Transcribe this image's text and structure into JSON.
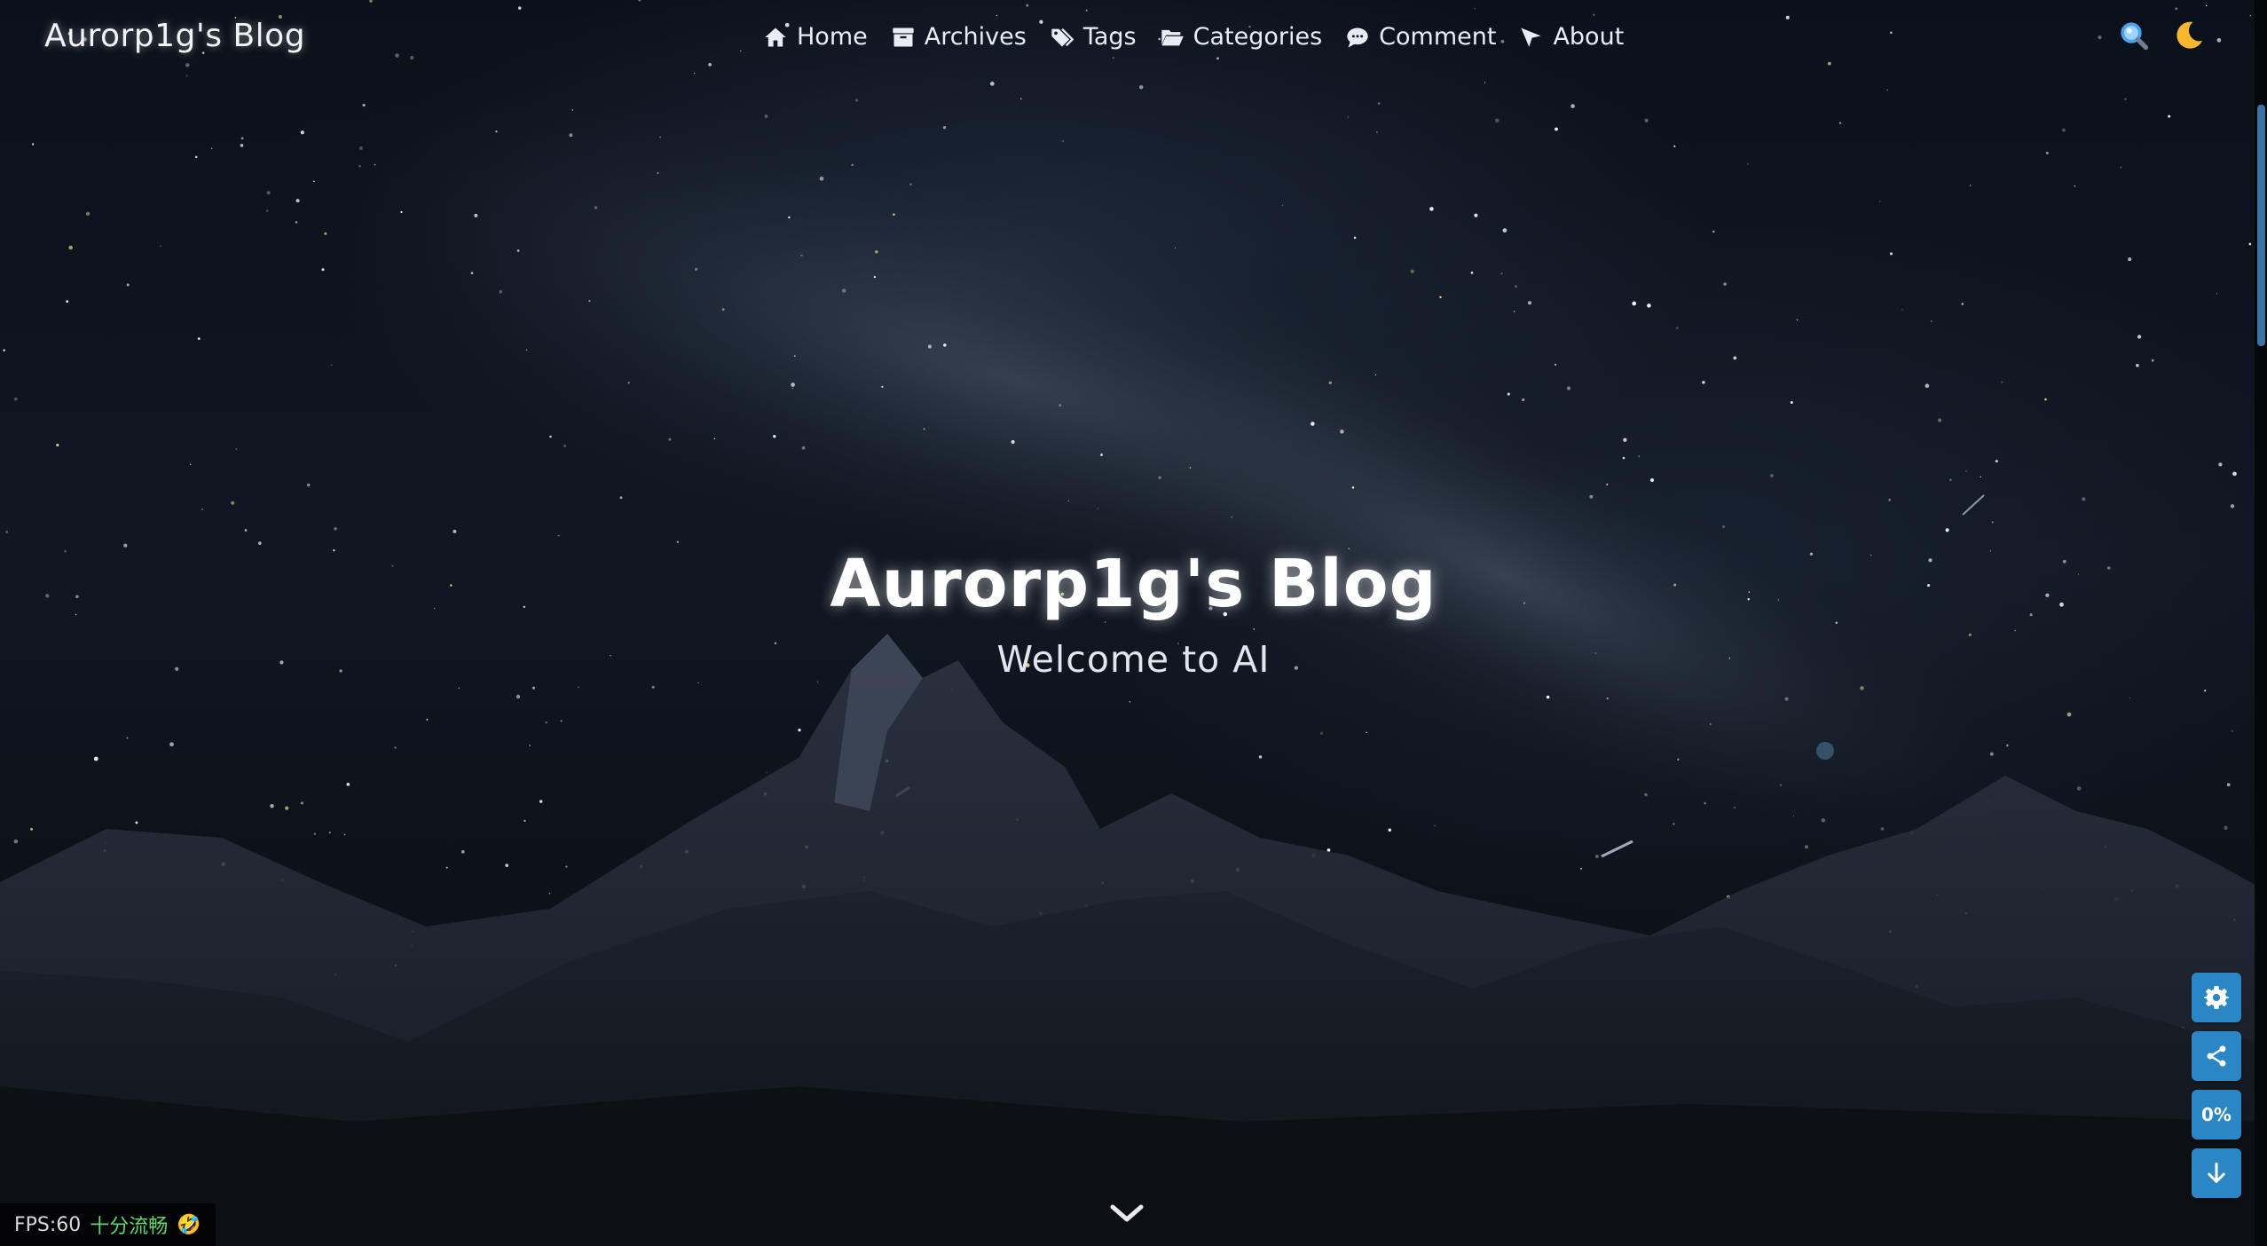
{
  "header": {
    "site_title": "Aurorp1g's Blog",
    "nav": [
      {
        "label": "Home",
        "icon": "home-icon"
      },
      {
        "label": "Archives",
        "icon": "archive-icon"
      },
      {
        "label": "Tags",
        "icon": "tags-icon"
      },
      {
        "label": "Categories",
        "icon": "folder-open-icon"
      },
      {
        "label": "Comment",
        "icon": "comment-icon"
      },
      {
        "label": "About",
        "icon": "paper-plane-icon"
      }
    ],
    "actions": {
      "search_icon": "search-icon",
      "theme_icon": "moon-icon"
    }
  },
  "hero": {
    "title": "Aurorp1g's Blog",
    "subtitle": "Welcome to AI"
  },
  "side_buttons": {
    "settings_icon": "gear-icon",
    "share_icon": "share-icon",
    "progress_label": "0%",
    "down_icon": "arrow-down-icon"
  },
  "fps": {
    "label": "FPS:60",
    "status": "十分流畅",
    "emoji": "🤣"
  },
  "colors": {
    "accent": "#2b86c5",
    "background": "#0d121a",
    "fps_good": "#5ed96a"
  }
}
